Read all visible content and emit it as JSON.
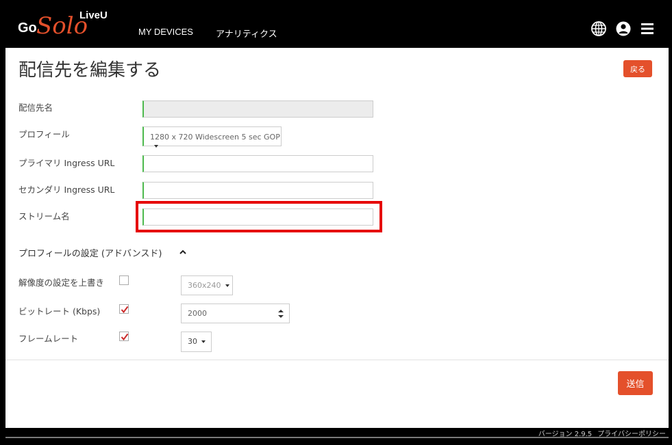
{
  "brand": {
    "go": "Go",
    "solo": "Solo",
    "liveu": "LiveU",
    "accent": "#e4502b"
  },
  "nav": {
    "devices": "MY DEVICES",
    "analytics": "アナリティクス"
  },
  "header_icons": [
    "globe-icon",
    "user-icon",
    "menu-icon"
  ],
  "page": {
    "title": "配信先を編集する",
    "back_label": "戻る",
    "submit_label": "送信"
  },
  "form": {
    "destination_name_label": "配信先名",
    "destination_name_value": "",
    "profile_label": "プロフィール",
    "profile_value": "1280 x 720 Widescreen 5 sec GOP",
    "primary_url_label": "プライマリ Ingress URL",
    "primary_url_value": "",
    "secondary_url_label": "セカンダリ Ingress URL",
    "secondary_url_value": "",
    "stream_name_label": "ストリーム名",
    "stream_name_value": ""
  },
  "advanced": {
    "title": "プロフィールの設定 (アドバンスド)",
    "resolution_label": "解像度の設定を上書き",
    "resolution_checked": false,
    "resolution_value": "360x240",
    "bitrate_label": "ビットレート (Kbps)",
    "bitrate_checked": true,
    "bitrate_value": "2000",
    "framerate_label": "フレームレート",
    "framerate_checked": true,
    "framerate_value": "30"
  },
  "footer": {
    "version": "バージョン 2.9.5",
    "privacy": "プライバシーポリシー"
  },
  "colors": {
    "field_accent": "#4cb94c",
    "highlight": "#e60000"
  }
}
